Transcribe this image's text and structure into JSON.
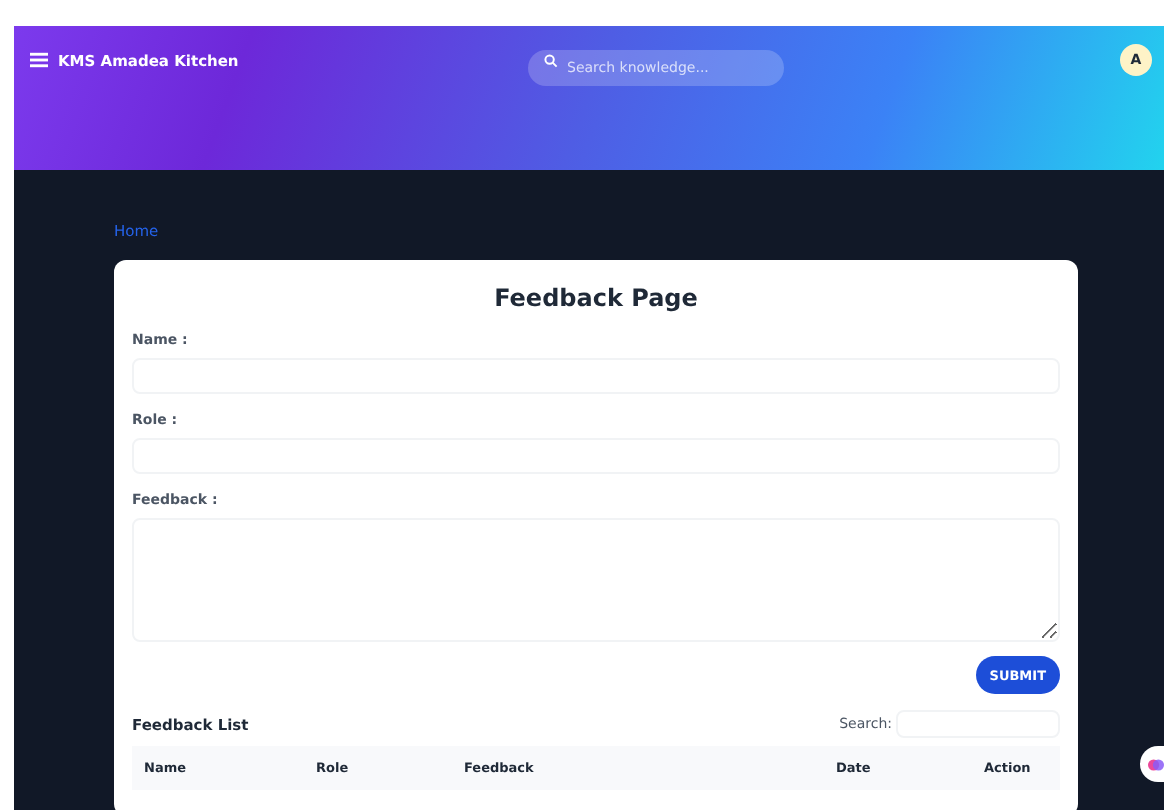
{
  "header": {
    "title": "KMS Amadea Kitchen",
    "search": {
      "placeholder": "Search knowledge..."
    },
    "avatar": "A"
  },
  "breadcrumb": "Home",
  "form": {
    "title": "Feedback Page",
    "fields": [
      {
        "label": "Name :",
        "kind": "input"
      },
      {
        "label": "Role :",
        "kind": "input"
      },
      {
        "label": "Feedback :",
        "kind": "textarea"
      }
    ],
    "submit": "SUBMIT"
  },
  "list": {
    "title": "Feedback List",
    "search_label": "Search:",
    "columns": [
      "Name",
      "Role",
      "Feedback",
      "Date",
      "Action"
    ]
  }
}
